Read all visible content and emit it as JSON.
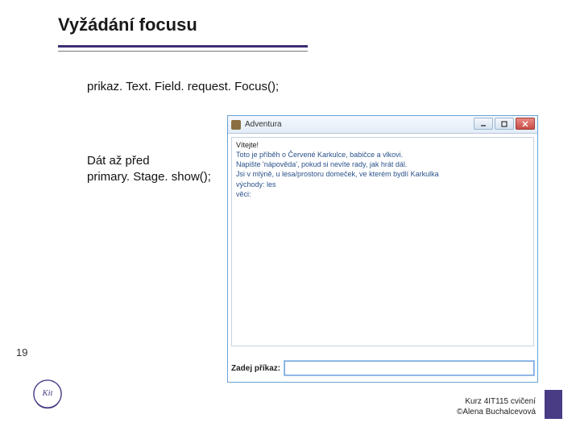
{
  "slide": {
    "title": "Vyžádání focusu",
    "code_line": "prikaz. Text. Field. request. Focus();",
    "note_line1": "Dát až před",
    "note_line2": "primary. Stage. show();",
    "page_number": "19"
  },
  "footer": {
    "line1": "Kurz 4IT115 cvičení",
    "line2": "©Alena Buchalcevová"
  },
  "window": {
    "title": "Adventura",
    "body": {
      "l1": "Vítejte!",
      "l2": "Toto je příběh o Červené Karkulce, babičce a vlkovi.",
      "l3": "Napište 'nápověda', pokud si nevíte rady, jak hrát dál.",
      "l4": "",
      "l5": "Jsi v mlýně, u lesa/prostoru domeček, ve kterém bydlí Karkulka",
      "l6": "východy: les",
      "l7": "věci:"
    },
    "cmd_label": "Zadej příkaz:",
    "cmd_value": ""
  }
}
